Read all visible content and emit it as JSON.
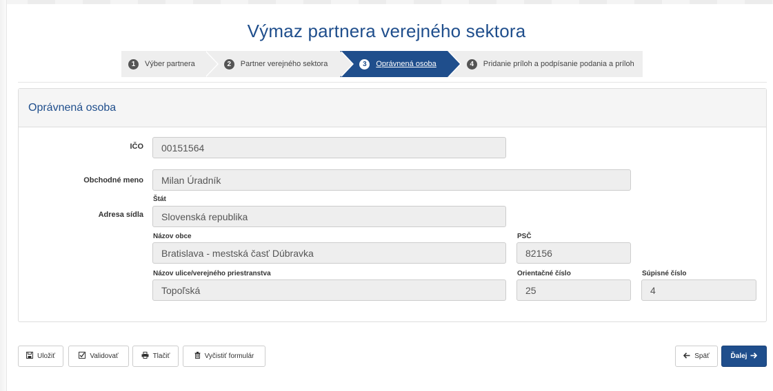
{
  "title": "Výmaz partnera verejného sektora",
  "wizard": {
    "steps": [
      {
        "num": "1",
        "label": "Výber partnera"
      },
      {
        "num": "2",
        "label": "Partner verejného sektora"
      },
      {
        "num": "3",
        "label": "Oprávnená osoba"
      },
      {
        "num": "4",
        "label": "Pridanie príloh a podpísanie podania a príloh"
      }
    ],
    "active_step": "3"
  },
  "panel": {
    "heading": "Oprávnená osoba"
  },
  "form": {
    "ico": {
      "label": "IČO",
      "value": "00151564"
    },
    "obchodne_meno": {
      "label": "Obchodné meno",
      "value": "Milan Úradník"
    },
    "adresa_label": "Adresa sídla",
    "stat": {
      "label": "Štát",
      "value": "Slovenská republika"
    },
    "nazov_obce": {
      "label": "Názov obce",
      "value": "Bratislava - mestská časť Dúbravka"
    },
    "psc": {
      "label": "PSČ",
      "value": "82156"
    },
    "ulica": {
      "label": "Názov ulice/verejného priestranstva",
      "value": "Topoľská"
    },
    "orientacne": {
      "label": "Orientačné číslo",
      "value": "25"
    },
    "supisne": {
      "label": "Súpisné číslo",
      "value": "4"
    }
  },
  "toolbar": {
    "save": "Uložiť",
    "validate": "Validovať",
    "print": "Tlačiť",
    "clear": "Vyčistiť formulár",
    "back": "Späť",
    "next": "Ďalej"
  },
  "icons": {
    "save": "floppy-disk-icon",
    "validate": "check-square-icon",
    "print": "printer-icon",
    "clear": "trash-icon",
    "back": "arrow-left-icon",
    "next": "arrow-right-icon"
  },
  "colors": {
    "brand": "#1f4e8c",
    "field_bg": "#eeeeee",
    "panel_heading_bg": "#f5f5f5"
  }
}
